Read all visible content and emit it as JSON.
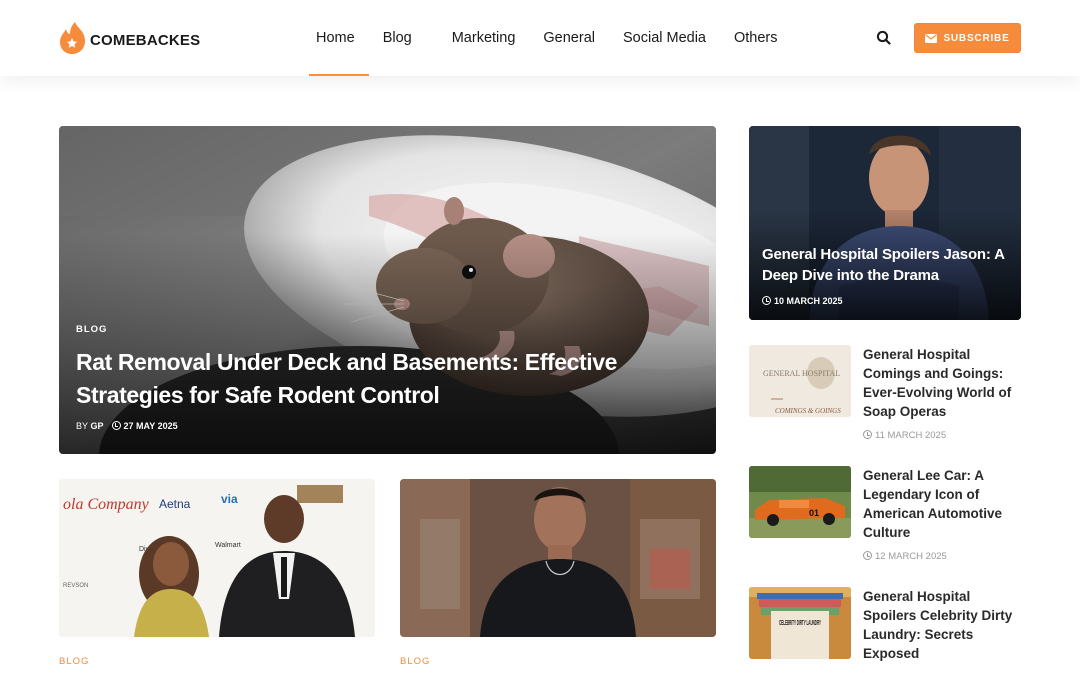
{
  "site": {
    "name": "COMEBACKES",
    "brand_color": "#f58b3b"
  },
  "nav": {
    "items": [
      {
        "label": "Home",
        "active": true
      },
      {
        "label": "Blog",
        "active": false
      },
      {
        "label": "Marketing",
        "active": false
      },
      {
        "label": "General",
        "active": false
      },
      {
        "label": "Social Media",
        "active": false
      },
      {
        "label": "Others",
        "active": false
      }
    ],
    "search_icon": "search-icon",
    "subscribe_label": "SUBSCRIBE",
    "subscribe_icon": "envelope-icon"
  },
  "hero": {
    "category": "BLOG",
    "title": "Rat Removal Under Deck and Basements: Effective Strategies for Safe Rodent Control",
    "by_prefix": "BY",
    "author": "GP",
    "date": "27 MAY 2025"
  },
  "cards": [
    {
      "category": "BLOG"
    },
    {
      "category": "BLOG"
    }
  ],
  "sidebar": {
    "feature": {
      "title": "General Hospital Spoilers Jason: A Deep Dive into the Drama",
      "date": "10 MARCH 2025"
    },
    "items": [
      {
        "title": "General Hospital Comings and Goings: Ever-Evolving World of Soap Operas",
        "date": "11 MARCH 2025",
        "thumb_text_top": "GENERAL HOSPITAL",
        "thumb_text_bottom": "COMINGS & GOINGS"
      },
      {
        "title": "General Lee Car: A Legendary Icon of American Automotive Culture",
        "date": "12 MARCH 2025",
        "thumb_text": "01"
      },
      {
        "title": "General Hospital Spoilers Celebrity Dirty Laundry: Secrets Exposed",
        "date": "",
        "thumb_text": "CELEBRITY DIRTY LAUNDRY"
      }
    ]
  }
}
